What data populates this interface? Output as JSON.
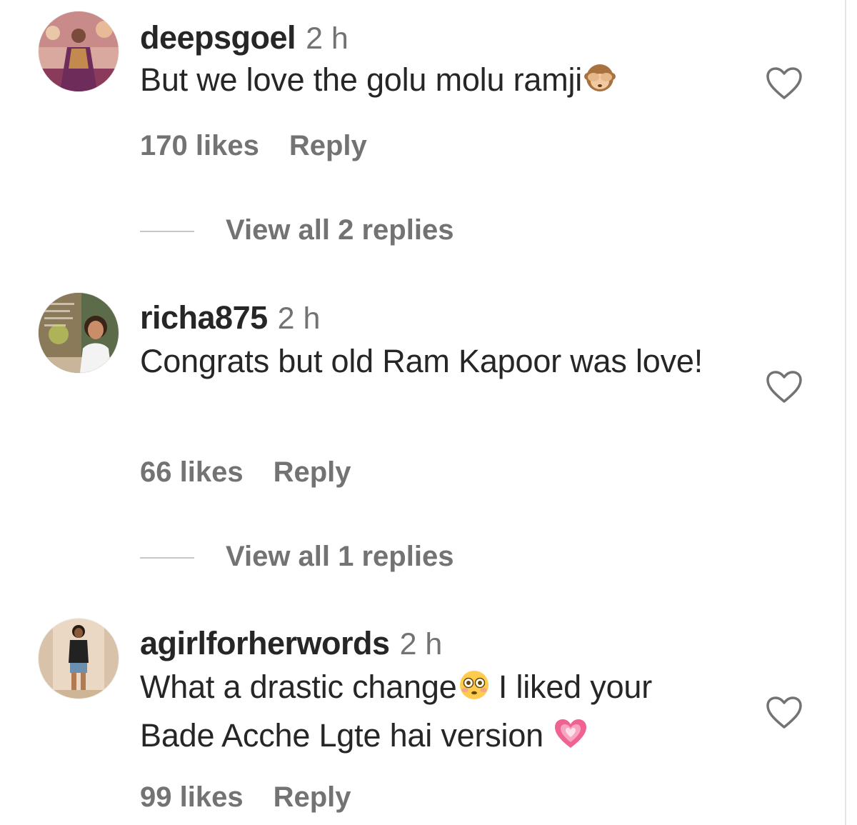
{
  "comments": [
    {
      "username": "deepsgoel",
      "time": "2 h",
      "text": "But we love the golu molu ramji",
      "likes": "170 likes",
      "reply": "Reply",
      "view_replies": "View all 2 replies",
      "emoji": "see-no-evil-monkey"
    },
    {
      "username": "richa875",
      "time": "2 h",
      "text": "Congrats but old Ram Kapoor was love!",
      "likes": "66 likes",
      "reply": "Reply",
      "view_replies": "View all 1 replies"
    },
    {
      "username": "agirlforherwords",
      "time": "2 h",
      "text_part1": "What a drastic change",
      "text_part2": " I liked your Bade Acche Lgte hai version ",
      "likes": "99 likes",
      "reply": "Reply",
      "emoji_1": "flushed-face",
      "emoji_2": "growing-heart"
    }
  ],
  "colors": {
    "primary_text": "#262626",
    "secondary_text": "#737373",
    "divider": "#c7c7c7",
    "background": "#ffffff"
  }
}
